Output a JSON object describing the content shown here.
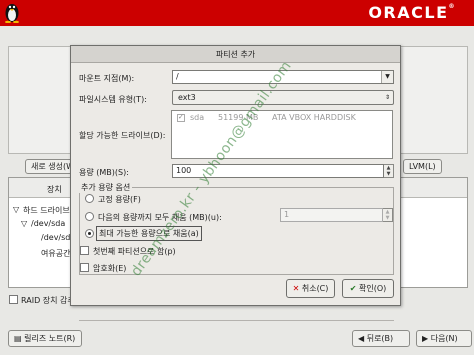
{
  "brand": {
    "logo_text": "ORACLE",
    "registered": "®"
  },
  "colors": {
    "brand_red": "#cc0000",
    "dialog_bg": "#eceae6"
  },
  "background": {
    "new_button": "새로 생성(W)",
    "lvm_button": "LVM(L)",
    "table_header": "장치",
    "tree": [
      "하드 드라이브",
      "/dev/sda",
      "/dev/sda",
      "여유공간"
    ],
    "raid_checkbox": "RAID 장치 감추",
    "release_notes_button": "릴리즈 노트(R)",
    "back_button": "뒤로(B)",
    "next_button": "다음(N)"
  },
  "dialog": {
    "title": "파티션 추가",
    "mount_point": {
      "label": "마운트 지점(M):",
      "value": "/"
    },
    "fs_type": {
      "label": "파일시스템 유형(T):",
      "value": "ext3"
    },
    "drives": {
      "label": "할당 가능한 드라이브(D):",
      "row": {
        "checked": true,
        "name": "sda",
        "size": "51199 MB",
        "model": "ATA VBOX HARDDISK"
      }
    },
    "size": {
      "label": "용량 (MB)(S):",
      "value": "100"
    },
    "options": {
      "title": "추가 용량 옵션",
      "fixed": "고정 용량(F)",
      "fill_upto": "다음의 용량까지 모두 채움 (MB)(u):",
      "fill_upto_value": "1",
      "fill_max": "최대 가능한 용량으로 채움(a)",
      "selected": "fill_max"
    },
    "primary_check": {
      "label": "첫번째 파티션으로 함(p)",
      "checked": false
    },
    "encrypt_check": {
      "label": "암호화(E)",
      "checked": false
    },
    "cancel_button": "취소(C)",
    "ok_button": "확인(O)"
  },
  "watermark": "dreamzero.kr - ybhoon@gmail.com"
}
